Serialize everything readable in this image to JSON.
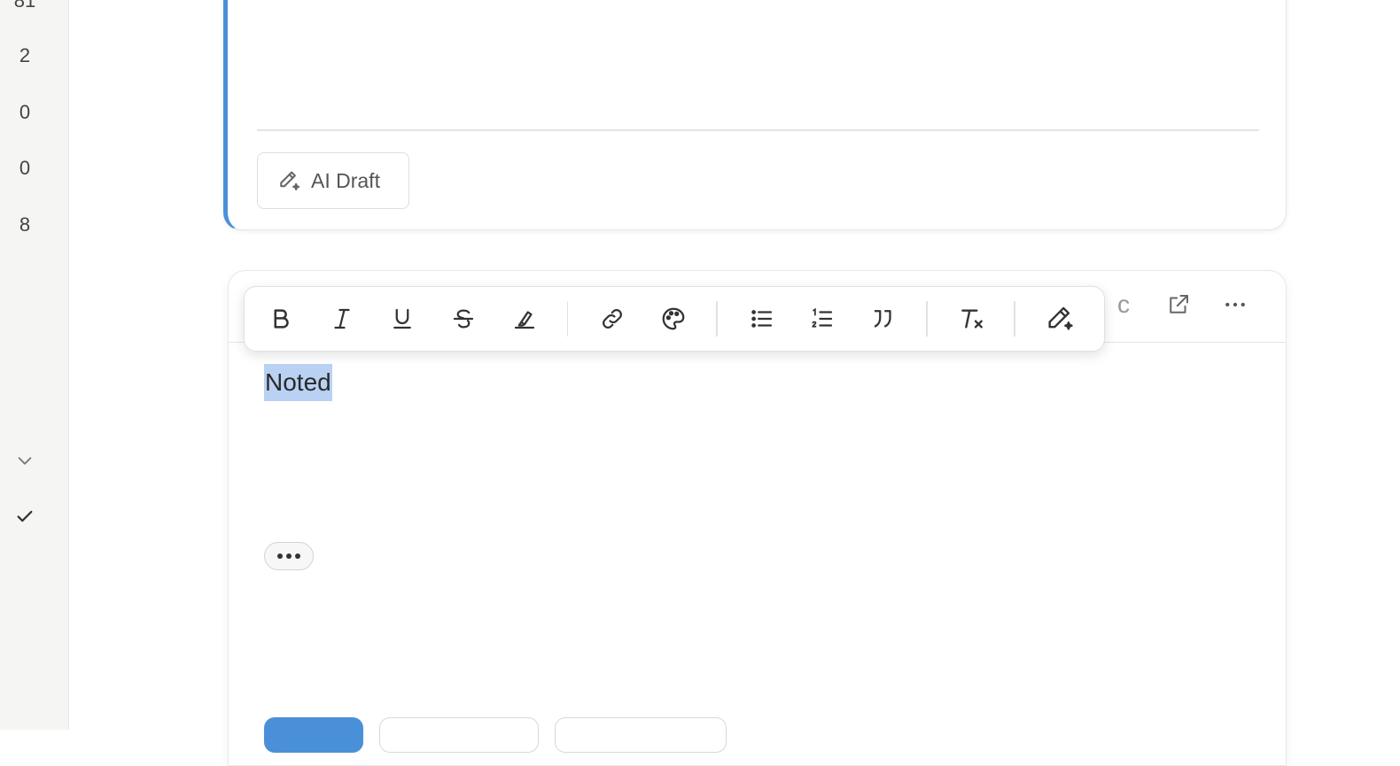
{
  "sidebar": {
    "counts": [
      "81",
      "2",
      "0",
      "0",
      "8"
    ],
    "icons": [
      "chevron-down-icon",
      "check-icon"
    ]
  },
  "prev_reply": {
    "ai_draft_label": "AI Draft",
    "accent_color": "#4a90d9"
  },
  "composer": {
    "header_partial_text": "c",
    "header_actions": [
      "popout-icon",
      "more-horizontal-icon"
    ],
    "toolbar": [
      "bold",
      "italic",
      "underline",
      "strikethrough",
      "highlight",
      "link",
      "text-color",
      "bullet-list",
      "numbered-list",
      "quote",
      "clear-formatting",
      "ai-edit"
    ],
    "body_text": "Noted",
    "selection_color": "#b9d2f3",
    "primary_color": "#4a90d9"
  }
}
